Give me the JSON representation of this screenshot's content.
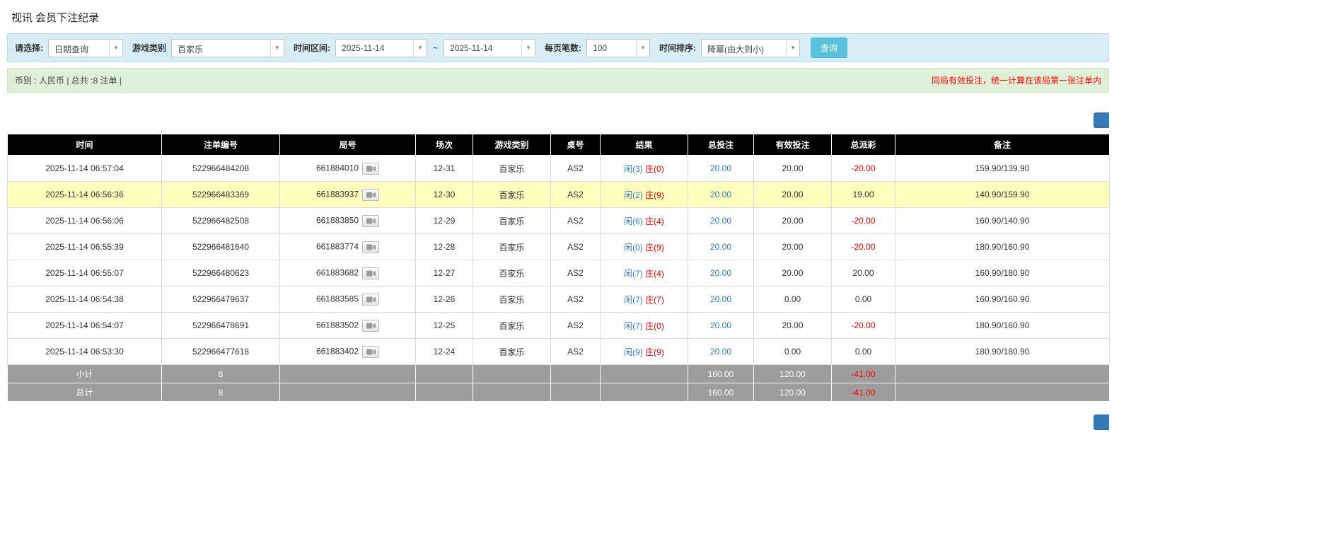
{
  "page": {
    "title": "视讯 会员下注纪录"
  },
  "filter_bar": {
    "select_label": "请选择:",
    "select_value": "日期查询",
    "game_type_label": "游戏类别",
    "game_type_value": "百家乐",
    "time_range_label": "时间区间:",
    "date_from": "2025-11-14",
    "range_separator": "~",
    "date_to": "2025-11-14",
    "page_size_label": "每页笔数:",
    "page_size_value": "100",
    "time_sort_label": "时间排序:",
    "time_sort_value": "降幂(由大到小)",
    "search_button_label": "查询"
  },
  "summary_bar": {
    "currency_info": "币别 : 人民币 | 总共 :8 注单 |",
    "notice": "同局有效投注，统一计算在该局第一张注单内"
  },
  "table": {
    "headers": [
      "时间",
      "注单编号",
      "局号",
      "场次",
      "游戏类别",
      "桌号",
      "结果",
      "总投注",
      "有效投注",
      "总派彩",
      "备注"
    ],
    "rows": [
      {
        "time": "2025-11-14 06:57:04",
        "bet_no": "522966484208",
        "round_no": "661884010",
        "session": "12-31",
        "game": "百家乐",
        "table_no": "AS2",
        "result_player": "闲(3)",
        "result_banker": "庄(0)",
        "total_bet": "20.00",
        "valid_bet": "20.00",
        "payout": "-20.00",
        "note": "159.90/139.90",
        "highlighted": false
      },
      {
        "time": "2025-11-14 06:56:36",
        "bet_no": "522966483369",
        "round_no": "661883937",
        "session": "12-30",
        "game": "百家乐",
        "table_no": "AS2",
        "result_player": "闲(2)",
        "result_banker": "庄(9)",
        "total_bet": "20.00",
        "valid_bet": "20.00",
        "payout": "19.00",
        "note": "140.90/159.90",
        "highlighted": true
      },
      {
        "time": "2025-11-14 06:56:06",
        "bet_no": "522966482508",
        "round_no": "661883850",
        "session": "12-29",
        "game": "百家乐",
        "table_no": "AS2",
        "result_player": "闲(6)",
        "result_banker": "庄(4)",
        "total_bet": "20.00",
        "valid_bet": "20.00",
        "payout": "-20.00",
        "note": "160.90/140.90",
        "highlighted": false
      },
      {
        "time": "2025-11-14 06:55:39",
        "bet_no": "522966481640",
        "round_no": "661883774",
        "session": "12-28",
        "game": "百家乐",
        "table_no": "AS2",
        "result_player": "闲(0)",
        "result_banker": "庄(9)",
        "total_bet": "20.00",
        "valid_bet": "20.00",
        "payout": "-20.00",
        "note": "180.90/160.90",
        "highlighted": false
      },
      {
        "time": "2025-11-14 06:55:07",
        "bet_no": "522966480623",
        "round_no": "661883682",
        "session": "12-27",
        "game": "百家乐",
        "table_no": "AS2",
        "result_player": "闲(7)",
        "result_banker": "庄(4)",
        "total_bet": "20.00",
        "valid_bet": "20.00",
        "payout": "20.00",
        "note": "160.90/180.90",
        "highlighted": false
      },
      {
        "time": "2025-11-14 06:54:38",
        "bet_no": "522966479637",
        "round_no": "661883585",
        "session": "12-26",
        "game": "百家乐",
        "table_no": "AS2",
        "result_player": "闲(7)",
        "result_banker": "庄(7)",
        "total_bet": "20.00",
        "valid_bet": "0.00",
        "payout": "0.00",
        "note": "160.90/160.90",
        "highlighted": false
      },
      {
        "time": "2025-11-14 06:54:07",
        "bet_no": "522966478691",
        "round_no": "661883502",
        "session": "12-25",
        "game": "百家乐",
        "table_no": "AS2",
        "result_player": "闲(7)",
        "result_banker": "庄(0)",
        "total_bet": "20.00",
        "valid_bet": "20.00",
        "payout": "-20.00",
        "note": "180.90/160.90",
        "highlighted": false
      },
      {
        "time": "2025-11-14 06:53:30",
        "bet_no": "522966477618",
        "round_no": "661883402",
        "session": "12-24",
        "game": "百家乐",
        "table_no": "AS2",
        "result_player": "闲(9)",
        "result_banker": "庄(9)",
        "total_bet": "20.00",
        "valid_bet": "0.00",
        "payout": "0.00",
        "note": "180.90/180.90",
        "highlighted": false
      }
    ],
    "footer": [
      {
        "label": "小计",
        "count": "8",
        "total_bet": "160.00",
        "valid_bet": "120.00",
        "payout": "-41.00"
      },
      {
        "label": "总计",
        "count": "8",
        "total_bet": "160.00",
        "valid_bet": "120.00",
        "payout": "-41.00"
      }
    ]
  },
  "colors": {
    "filter_bg": "#d9edf7",
    "summary_bg": "#dff0d8",
    "search_button_bg": "#5bc0de",
    "corner_button_bg": "#337ab7",
    "header_bg": "#000000",
    "highlight_row": "#ffffbe",
    "footer_bg": "#9d9d9d",
    "link_blue": "#337ab7",
    "player_blue": "#337ab7",
    "banker_red": "#e00000",
    "negative_red": "#e00000",
    "notice_red": "#ff0000"
  }
}
